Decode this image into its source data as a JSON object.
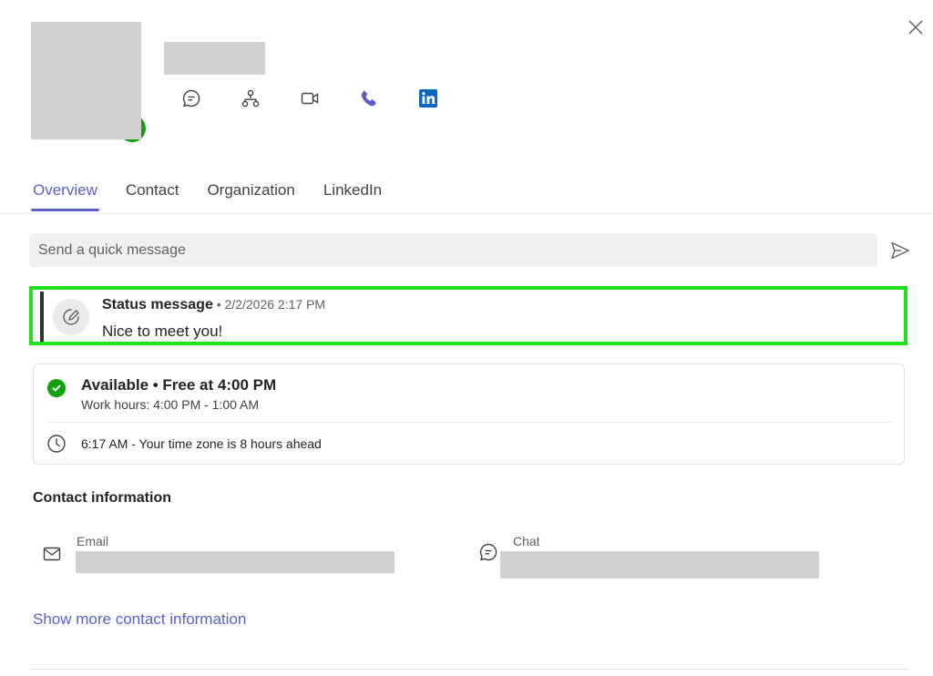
{
  "header": {
    "actions": [
      {
        "name": "chat",
        "icon": "chat-icon"
      },
      {
        "name": "org-chart",
        "icon": "org-chart-icon"
      },
      {
        "name": "video-call",
        "icon": "video-camera-icon"
      },
      {
        "name": "audio-call",
        "icon": "phone-icon"
      },
      {
        "name": "linkedin",
        "icon": "linkedin-icon"
      }
    ],
    "close_icon": "close-icon"
  },
  "tabs": [
    {
      "label": "Overview",
      "active": true
    },
    {
      "label": "Contact",
      "active": false
    },
    {
      "label": "Organization",
      "active": false
    },
    {
      "label": "LinkedIn",
      "active": false
    }
  ],
  "quick_message": {
    "placeholder": "Send a quick message",
    "send_icon": "send-icon"
  },
  "status_message": {
    "title": "Status message",
    "separator": " • ",
    "timestamp": "2/2/2026 2:17 PM",
    "text": "Nice to meet you!",
    "icon": "status-edit-icon"
  },
  "availability": {
    "title": "Available • Free at 4:00 PM",
    "work_hours": "Work hours: 4:00 PM - 1:00 AM",
    "local_time": "6:17 AM - Your time zone is 8 hours ahead"
  },
  "contact_info": {
    "heading": "Contact information",
    "email_label": "Email",
    "chat_label": "Chat",
    "show_more": "Show more contact information"
  },
  "colors": {
    "accent": "#5b5fc7",
    "available": "#13a10e",
    "highlight_border": "#22e01a",
    "linkedin": "#0a66c2"
  }
}
